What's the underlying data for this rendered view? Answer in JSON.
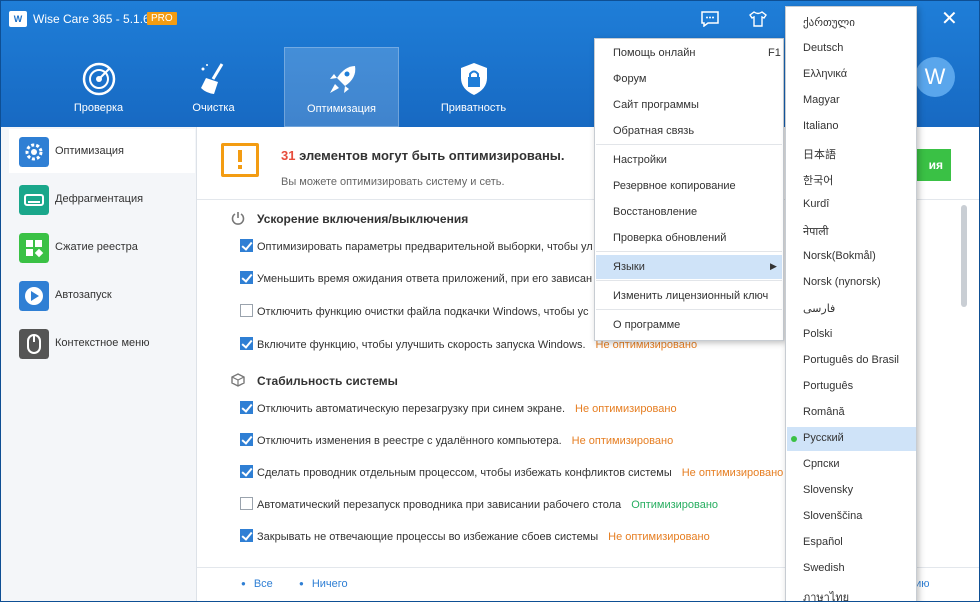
{
  "app": {
    "title": "Wise Care 365 - 5.1.6",
    "badge": "PRO",
    "logo_text": "W",
    "avatar_letter": "W"
  },
  "nav": [
    {
      "label": "Проверка",
      "icon": "radar-icon"
    },
    {
      "label": "Очистка",
      "icon": "broom-icon"
    },
    {
      "label": "Оптимизация",
      "icon": "rocket-icon",
      "active": true
    },
    {
      "label": "Приватность",
      "icon": "lock-icon"
    }
  ],
  "sidebar": {
    "items": [
      {
        "label": "Оптимизация",
        "icon": "gear-icon",
        "color": "#2f7fd4"
      },
      {
        "label": "Дефрагментация",
        "icon": "disk-icon",
        "color": "#1aa78b"
      },
      {
        "label": "Сжатие реестра",
        "icon": "registry-icon",
        "color": "#3ac145"
      },
      {
        "label": "Автозапуск",
        "icon": "play-icon",
        "color": "#2f7fd4"
      },
      {
        "label": "Контекстное меню",
        "icon": "mouse-icon",
        "color": "#555555"
      }
    ]
  },
  "banner": {
    "count": "31",
    "title": "элементов могут быть оптимизированы.",
    "subtitle": "Вы можете оптимизировать систему и сеть.",
    "button_label": "ия"
  },
  "sections": [
    {
      "title": "Ускорение включения/выключения",
      "icon": "power-icon",
      "rows": [
        {
          "text": "Оптимизировать параметры предварительной выборки, чтобы ул",
          "checked": true,
          "status": ""
        },
        {
          "text": "Уменьшить время ожидания ответа приложений, при его зависан",
          "checked": true,
          "status": ""
        },
        {
          "text": "Отключить функцию очистки файла подкачки Windows, чтобы ус",
          "checked": false,
          "status": ""
        },
        {
          "text": "Включите функцию, чтобы улучшить скорость запуска Windows.",
          "checked": true,
          "status": "Не оптимизировано"
        }
      ]
    },
    {
      "title": "Стабильность системы",
      "icon": "cube-icon",
      "rows": [
        {
          "text": "Отключить автоматическую перезагрузку при синем экране.",
          "checked": true,
          "status": "Не оптимизировано"
        },
        {
          "text": "Отключить изменения в реестре с удалённого компьютера.",
          "checked": true,
          "status": "Не оптимизировано"
        },
        {
          "text": "Сделать проводник отдельным процессом, чтобы избежать конфликтов системы",
          "checked": true,
          "status": "Не оптимизировано"
        },
        {
          "text": "Автоматический перезапуск проводника при зависании рабочего стола",
          "checked": false,
          "status": "Оптимизировано",
          "ok": true
        },
        {
          "text": "Закрывать не отвечающие процессы во избежание сбоев системы",
          "checked": true,
          "status": "Не оптимизировано"
        }
      ]
    }
  ],
  "footer": {
    "all": "Все",
    "none": "Ничего",
    "right": "иию"
  },
  "menu": {
    "items": [
      {
        "label": "Помощь онлайн",
        "shortcut": "F1"
      },
      {
        "label": "Форум"
      },
      {
        "label": "Сайт программы"
      },
      {
        "label": "Обратная связь"
      },
      {
        "label": "Настройки"
      },
      {
        "label": "Резервное копирование"
      },
      {
        "label": "Восстановление"
      },
      {
        "label": "Проверка обновлений"
      },
      {
        "label": "Языки",
        "submenu": true,
        "hover": true
      },
      {
        "label": "Изменить лицензионный ключ"
      },
      {
        "label": "О программе"
      }
    ]
  },
  "languages": {
    "selected": "Русский",
    "items": [
      "ქართული",
      "Deutsch",
      "Ελληνικά",
      "Magyar",
      "Italiano",
      "日本語",
      "한국어",
      "Kurdî",
      "नेपाली",
      "Norsk(Bokmål)",
      "Norsk (nynorsk)",
      "فارسی",
      "Polski",
      "Português do Brasil",
      "Português",
      "Română",
      "Русский",
      "Српски",
      "Slovensky",
      "Slovenščina",
      "Español",
      "Swedish",
      "ภาษาไทย"
    ]
  }
}
